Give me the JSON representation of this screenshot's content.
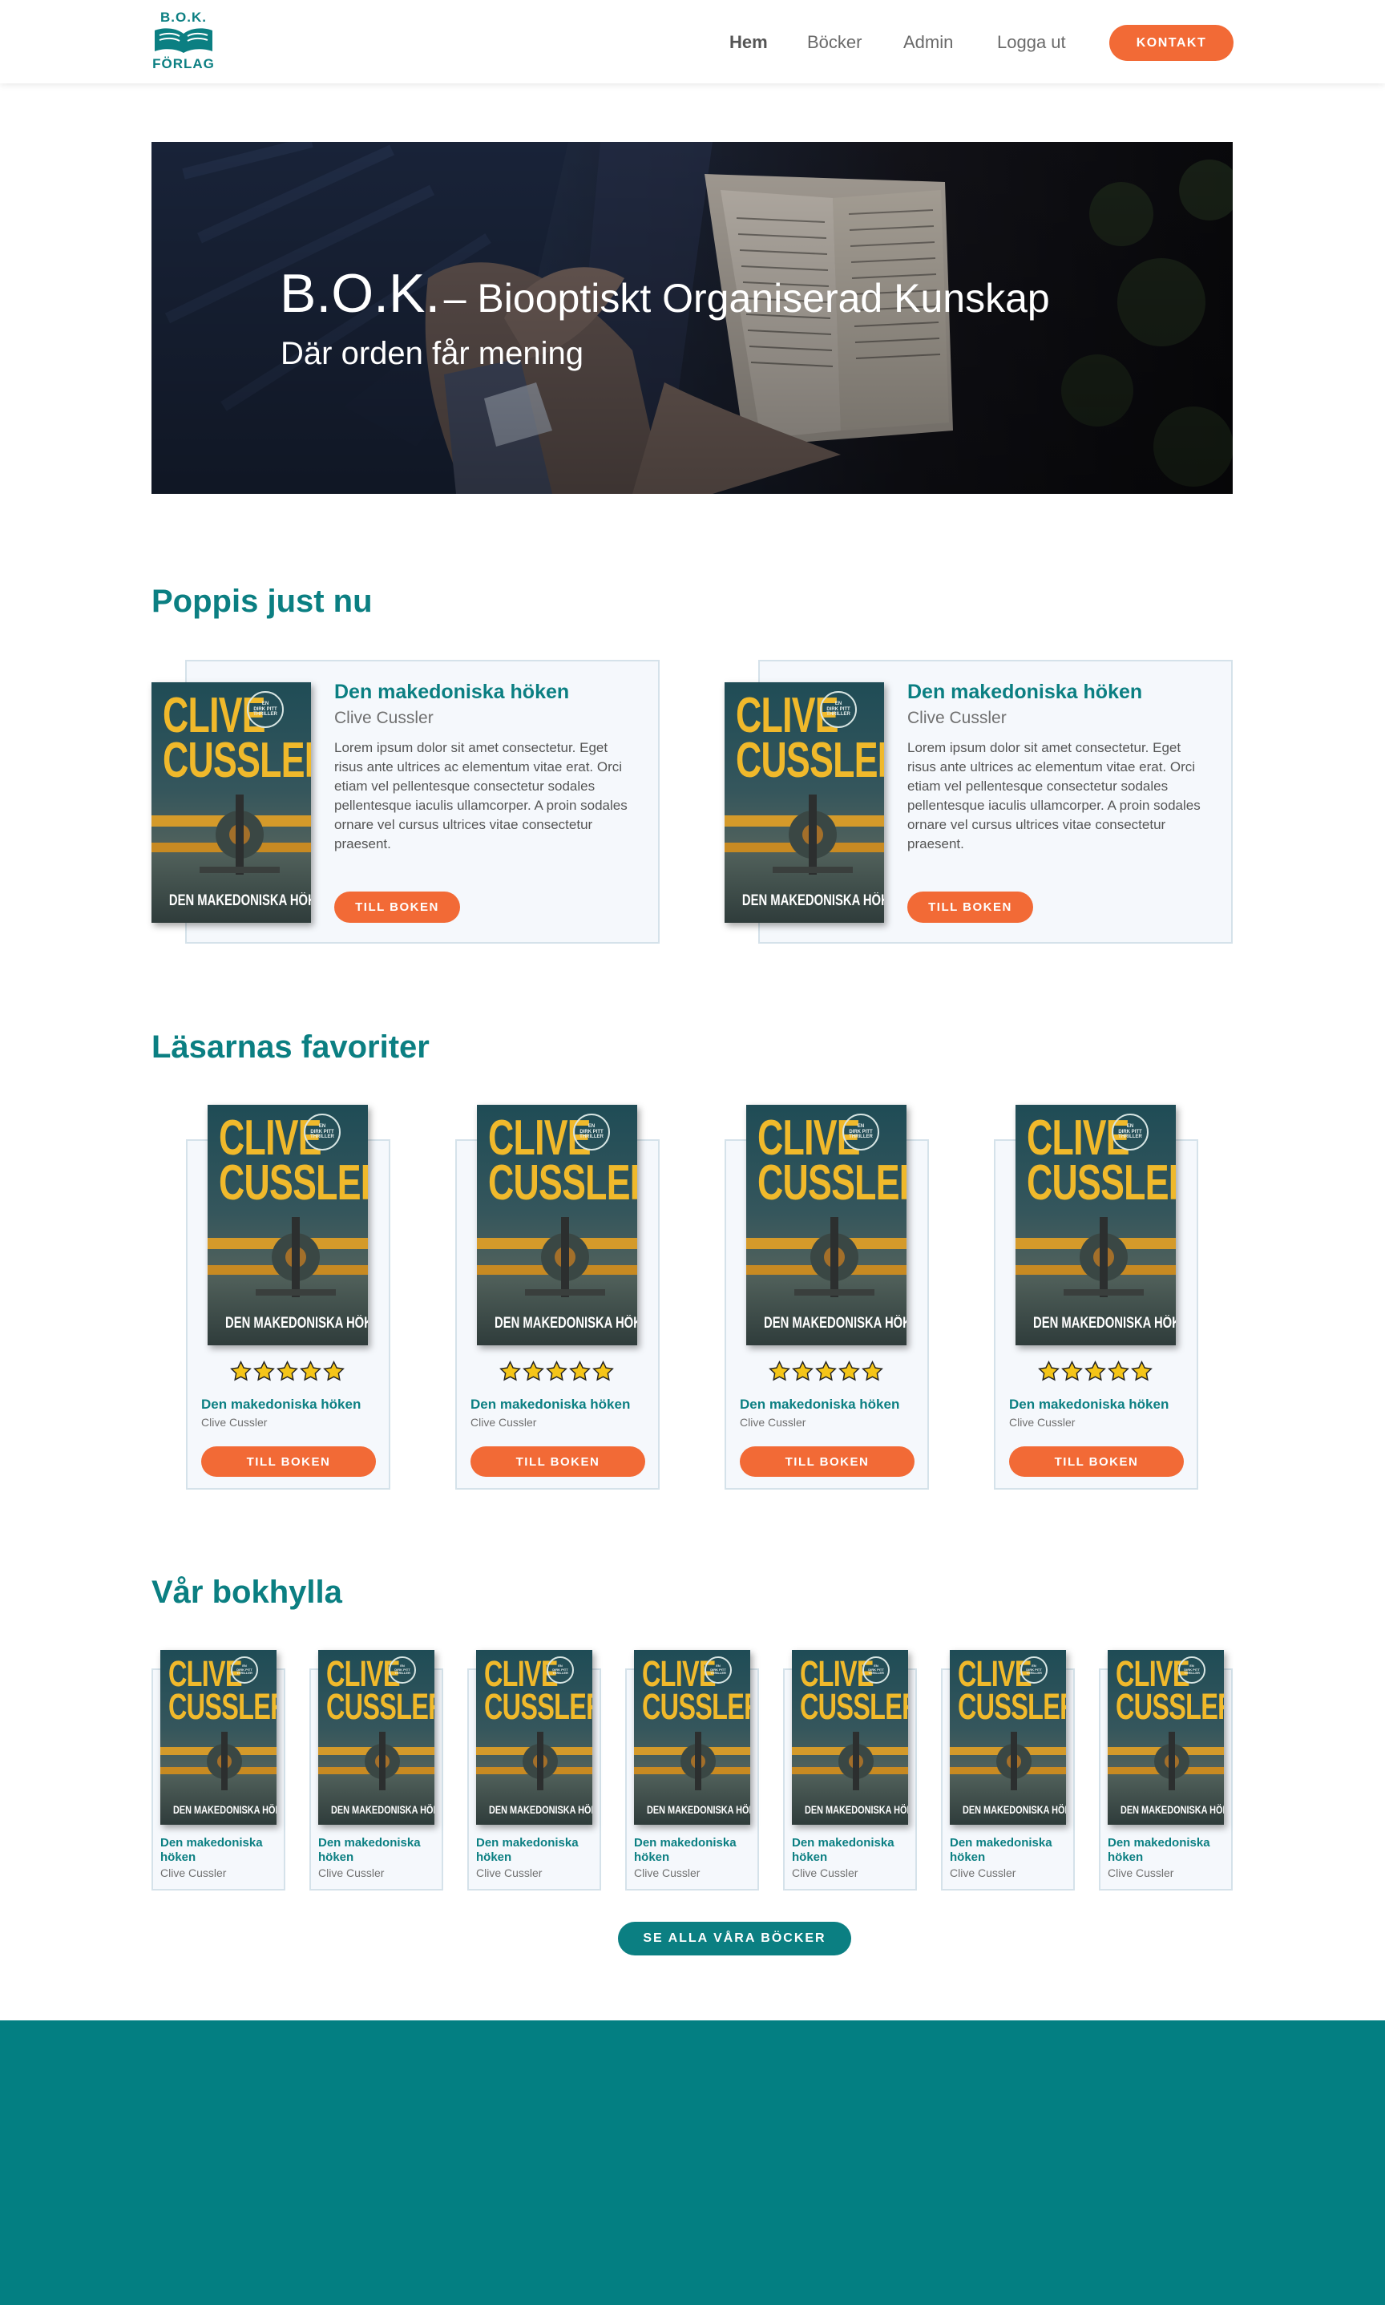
{
  "header": {
    "logo": {
      "line1": "B.O.K.",
      "line2": "FÖRLAG"
    },
    "nav": [
      "Hem",
      "Böcker",
      "Admin",
      "Logga ut"
    ],
    "active_nav": "Hem",
    "contact_button": "KONTAKT"
  },
  "hero": {
    "title_main": "B.O.K.",
    "title_rest": "– Biooptiskt Organiserad Kunskap",
    "subtitle": "Där orden får mening"
  },
  "popular": {
    "heading": "Poppis just nu",
    "items": [
      {
        "title": "Den makedoniska höken",
        "author": "Clive Cussler",
        "description_lines": [
          "Lorem ipsum dolor sit amet consectetur. Eget",
          "risus ante ultrices ac elementum vitae erat. Orci",
          "etiam vel pellentesque consectetur sodales",
          "pellentesque iaculis ullamcorper. A proin sodales",
          "ornare vel cursus ultrices vitae consectetur",
          "praesent."
        ],
        "button": "TILL BOKEN"
      },
      {
        "title": "Den makedoniska höken",
        "author": "Clive Cussler",
        "description_lines": [
          "Lorem ipsum dolor sit amet consectetur. Eget",
          "risus ante ultrices ac elementum vitae erat. Orci",
          "etiam vel pellentesque consectetur sodales",
          "pellentesque iaculis ullamcorper. A proin sodales",
          "ornare vel cursus ultrices vitae consectetur",
          "praesent."
        ],
        "button": "TILL BOKEN"
      }
    ]
  },
  "favorites": {
    "heading": "Läsarnas favoriter",
    "items": [
      {
        "title": "Den makedoniska höken",
        "author": "Clive Cussler",
        "rating": 5,
        "button": "TILL BOKEN"
      },
      {
        "title": "Den makedoniska höken",
        "author": "Clive Cussler",
        "rating": 5,
        "button": "TILL BOKEN"
      },
      {
        "title": "Den makedoniska höken",
        "author": "Clive Cussler",
        "rating": 5,
        "button": "TILL BOKEN"
      },
      {
        "title": "Den makedoniska höken",
        "author": "Clive Cussler",
        "rating": 5,
        "button": "TILL BOKEN"
      }
    ]
  },
  "shelf": {
    "heading": "Vår bokhylla",
    "items": [
      {
        "title_line1": "Den makedoniska",
        "title_line2": "höken",
        "author": "Clive Cussler"
      },
      {
        "title_line1": "Den makedoniska",
        "title_line2": "höken",
        "author": "Clive Cussler"
      },
      {
        "title_line1": "Den makedoniska",
        "title_line2": "höken",
        "author": "Clive Cussler"
      },
      {
        "title_line1": "Den makedoniska",
        "title_line2": "höken",
        "author": "Clive Cussler"
      },
      {
        "title_line1": "Den makedoniska",
        "title_line2": "höken",
        "author": "Clive Cussler"
      },
      {
        "title_line1": "Den makedoniska",
        "title_line2": "höken",
        "author": "Clive Cussler"
      },
      {
        "title_line1": "Den makedoniska",
        "title_line2": "höken",
        "author": "Clive Cussler"
      }
    ],
    "all_books_button": "SE ALLA VÅRA BÖCKER"
  },
  "book_cover": {
    "author_line1": "CLIVE",
    "author_line2": "CUSSLER",
    "seal_lines": [
      "EN",
      "DIRK PITT",
      "THRILLER"
    ],
    "title": "DEN MAKEDONISKA HÖKEN"
  },
  "colors": {
    "teal": "#0b7f82",
    "orange": "#f26a36",
    "footer": "#037f82",
    "card_bg": "#f5f8fc"
  }
}
